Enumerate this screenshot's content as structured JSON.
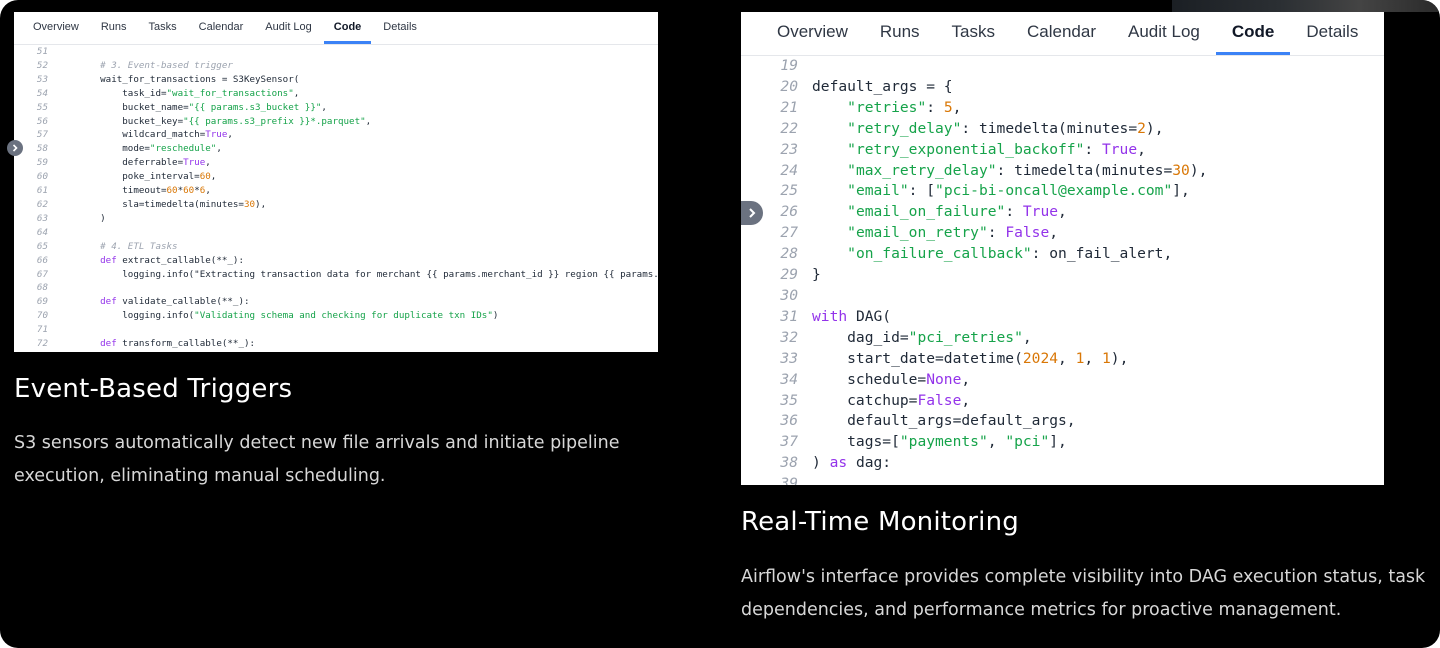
{
  "tabs": [
    "Overview",
    "Runs",
    "Tasks",
    "Calendar",
    "Audit Log",
    "Code",
    "Details"
  ],
  "active_tab": "Code",
  "left_panel": {
    "code_lines": [
      {
        "n": "51",
        "t": ""
      },
      {
        "n": "52",
        "t": "    # 3. Event-based trigger"
      },
      {
        "n": "53",
        "t": "    wait_for_transactions = S3KeySensor("
      },
      {
        "n": "54",
        "t": "        task_id=\"wait_for_transactions\","
      },
      {
        "n": "55",
        "t": "        bucket_name=\"{{ params.s3_bucket }}\","
      },
      {
        "n": "56",
        "t": "        bucket_key=\"{{ params.s3_prefix }}*.parquet\","
      },
      {
        "n": "57",
        "t": "        wildcard_match=True,"
      },
      {
        "n": "58",
        "t": "        mode=\"reschedule\","
      },
      {
        "n": "59",
        "t": "        deferrable=True,"
      },
      {
        "n": "60",
        "t": "        poke_interval=60,"
      },
      {
        "n": "61",
        "t": "        timeout=60*60*6,"
      },
      {
        "n": "62",
        "t": "        sla=timedelta(minutes=30),"
      },
      {
        "n": "63",
        "t": "    )"
      },
      {
        "n": "64",
        "t": ""
      },
      {
        "n": "65",
        "t": "    # 4. ETL Tasks"
      },
      {
        "n": "66",
        "t": "    def extract_callable(**_):"
      },
      {
        "n": "67",
        "t": "        logging.info(\"Extracting transaction data for merchant {{ params.merchant_id }} region {{ params.re"
      },
      {
        "n": "68",
        "t": ""
      },
      {
        "n": "69",
        "t": "    def validate_callable(**_):"
      },
      {
        "n": "70",
        "t": "        logging.info(\"Validating schema and checking for duplicate txn IDs\")"
      },
      {
        "n": "71",
        "t": ""
      },
      {
        "n": "72",
        "t": "    def transform_callable(**_):"
      }
    ]
  },
  "right_panel": {
    "code_lines": [
      {
        "n": "19",
        "t": ""
      },
      {
        "n": "20",
        "t": "default_args = {"
      },
      {
        "n": "21",
        "t": "    \"retries\": 5,"
      },
      {
        "n": "22",
        "t": "    \"retry_delay\": timedelta(minutes=2),"
      },
      {
        "n": "23",
        "t": "    \"retry_exponential_backoff\": True,"
      },
      {
        "n": "24",
        "t": "    \"max_retry_delay\": timedelta(minutes=30),"
      },
      {
        "n": "25",
        "t": "    \"email\": [\"pci-bi-oncall@example.com\"],"
      },
      {
        "n": "26",
        "t": "    \"email_on_failure\": True,"
      },
      {
        "n": "27",
        "t": "    \"email_on_retry\": False,"
      },
      {
        "n": "28",
        "t": "    \"on_failure_callback\": on_fail_alert,"
      },
      {
        "n": "29",
        "t": "}"
      },
      {
        "n": "30",
        "t": ""
      },
      {
        "n": "31",
        "t": "with DAG("
      },
      {
        "n": "32",
        "t": "    dag_id=\"pci_retries\","
      },
      {
        "n": "33",
        "t": "    start_date=datetime(2024, 1, 1),"
      },
      {
        "n": "34",
        "t": "    schedule=None,"
      },
      {
        "n": "35",
        "t": "    catchup=False,"
      },
      {
        "n": "36",
        "t": "    default_args=default_args,"
      },
      {
        "n": "37",
        "t": "    tags=[\"payments\", \"pci\"],"
      },
      {
        "n": "38",
        "t": ") as dag:"
      },
      {
        "n": "39",
        "t": ""
      }
    ]
  },
  "captions": {
    "left_title": "Event-Based Triggers",
    "left_body": "S3 sensors automatically detect new file arrivals and initiate pipeline execution, eliminating manual scheduling.",
    "right_title": "Real-Time Monitoring",
    "right_body": "Airflow's interface provides complete visibility into DAG execution status, task dependencies, and performance metrics for proactive management."
  },
  "colors": {
    "background": "#000000",
    "active_tab_underline": "#3b82f6",
    "string": "#16a34a",
    "keyword": "#9333ea",
    "number": "#d97706",
    "comment": "#9ca3af"
  },
  "icons": {
    "scroll_handle": "chevron-right-icon"
  }
}
